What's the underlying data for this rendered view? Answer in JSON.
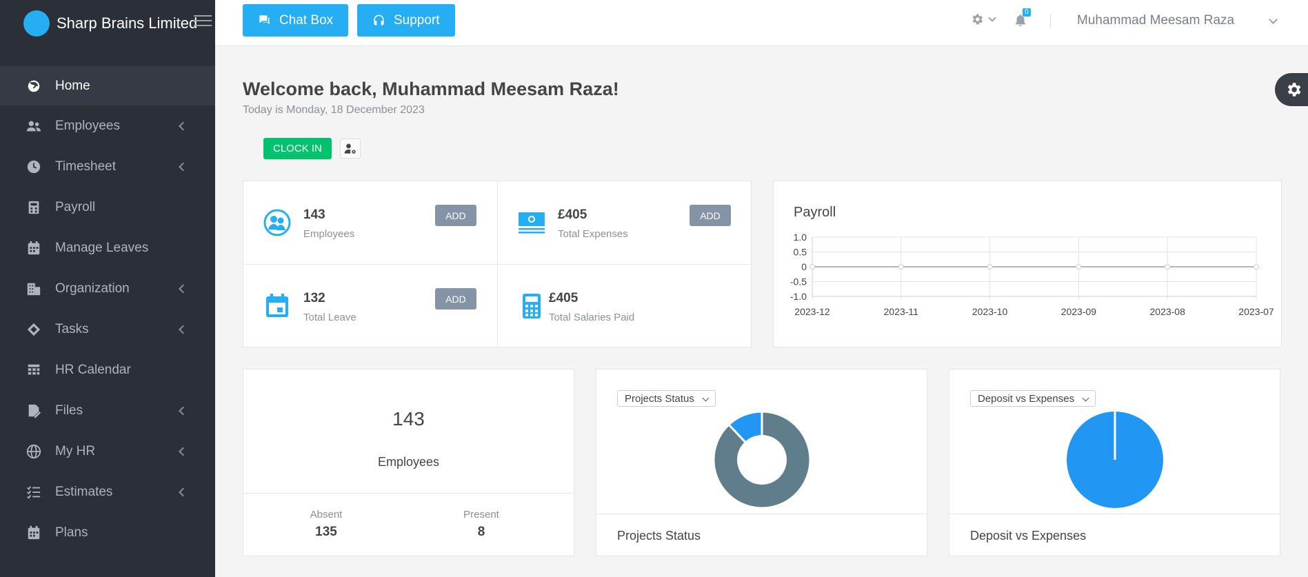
{
  "brand": {
    "name": "Sharp Brains Limited",
    "logo_color": "#26aef5"
  },
  "sidebar": {
    "items": [
      {
        "label": "Home",
        "icon": "speedometer-icon",
        "active": true,
        "submenu": false
      },
      {
        "label": "Employees",
        "icon": "users-icon",
        "active": false,
        "submenu": true
      },
      {
        "label": "Timesheet",
        "icon": "clock-icon",
        "active": false,
        "submenu": true
      },
      {
        "label": "Payroll",
        "icon": "calculator-icon",
        "active": false,
        "submenu": false
      },
      {
        "label": "Manage Leaves",
        "icon": "calendar-icon",
        "active": false,
        "submenu": false
      },
      {
        "label": "Organization",
        "icon": "building-icon",
        "active": false,
        "submenu": true
      },
      {
        "label": "Tasks",
        "icon": "diamond-icon",
        "active": false,
        "submenu": true
      },
      {
        "label": "HR Calendar",
        "icon": "calendar-grid-icon",
        "active": false,
        "submenu": false
      },
      {
        "label": "Files",
        "icon": "file-edit-icon",
        "active": false,
        "submenu": true
      },
      {
        "label": "My HR",
        "icon": "globe-icon",
        "active": false,
        "submenu": true
      },
      {
        "label": "Estimates",
        "icon": "checklist-icon",
        "active": false,
        "submenu": true
      },
      {
        "label": "Plans",
        "icon": "calendar-icon",
        "active": false,
        "submenu": false
      }
    ]
  },
  "topbar": {
    "chat_label": "Chat Box",
    "support_label": "Support",
    "notification_count": "0",
    "user_name": "Muhammad Meesam Raza"
  },
  "welcome": {
    "title": "Welcome back, Muhammad Meesam Raza!",
    "today": "Today is Monday, 18 December 2023",
    "clock_in_label": "CLOCK IN"
  },
  "stats": {
    "employees": {
      "value": "143",
      "label": "Employees",
      "add": "ADD"
    },
    "expenses": {
      "value": "£405",
      "label": "Total Expenses",
      "add": "ADD"
    },
    "leave": {
      "value": "132",
      "label": "Total Leave",
      "add": "ADD"
    },
    "salaries": {
      "value": "£405",
      "label": "Total Salaries Paid"
    }
  },
  "payroll": {
    "title": "Payroll"
  },
  "chart_data": [
    {
      "type": "line",
      "title": "Payroll",
      "x": [
        "2023-12",
        "2023-11",
        "2023-10",
        "2023-09",
        "2023-08",
        "2023-07"
      ],
      "series": [
        {
          "values": [
            0,
            0,
            0,
            0,
            0,
            0
          ]
        }
      ],
      "ylim": [
        -1.0,
        1.0
      ],
      "yticks": [
        "1.0",
        "0.5",
        "0",
        "-0.5",
        "-1.0"
      ],
      "grid": true
    },
    {
      "type": "pie",
      "title": "Projects Status",
      "style": "donut",
      "slices": [
        {
          "value": 88,
          "color": "#607d8b"
        },
        {
          "value": 12,
          "color": "#2196f3"
        }
      ]
    },
    {
      "type": "pie",
      "title": "Deposit vs Expenses",
      "slices": [
        {
          "value": 100,
          "color": "#2196f3"
        }
      ]
    }
  ],
  "employees_card": {
    "total": "143",
    "label": "Employees",
    "absent_label": "Absent",
    "absent_value": "135",
    "present_label": "Present",
    "present_value": "8"
  },
  "projects_card": {
    "dropdown": "Projects Status",
    "footer": "Projects Status"
  },
  "deposit_card": {
    "dropdown": "Deposit vs Expenses",
    "footer": "Deposit vs Expenses"
  }
}
